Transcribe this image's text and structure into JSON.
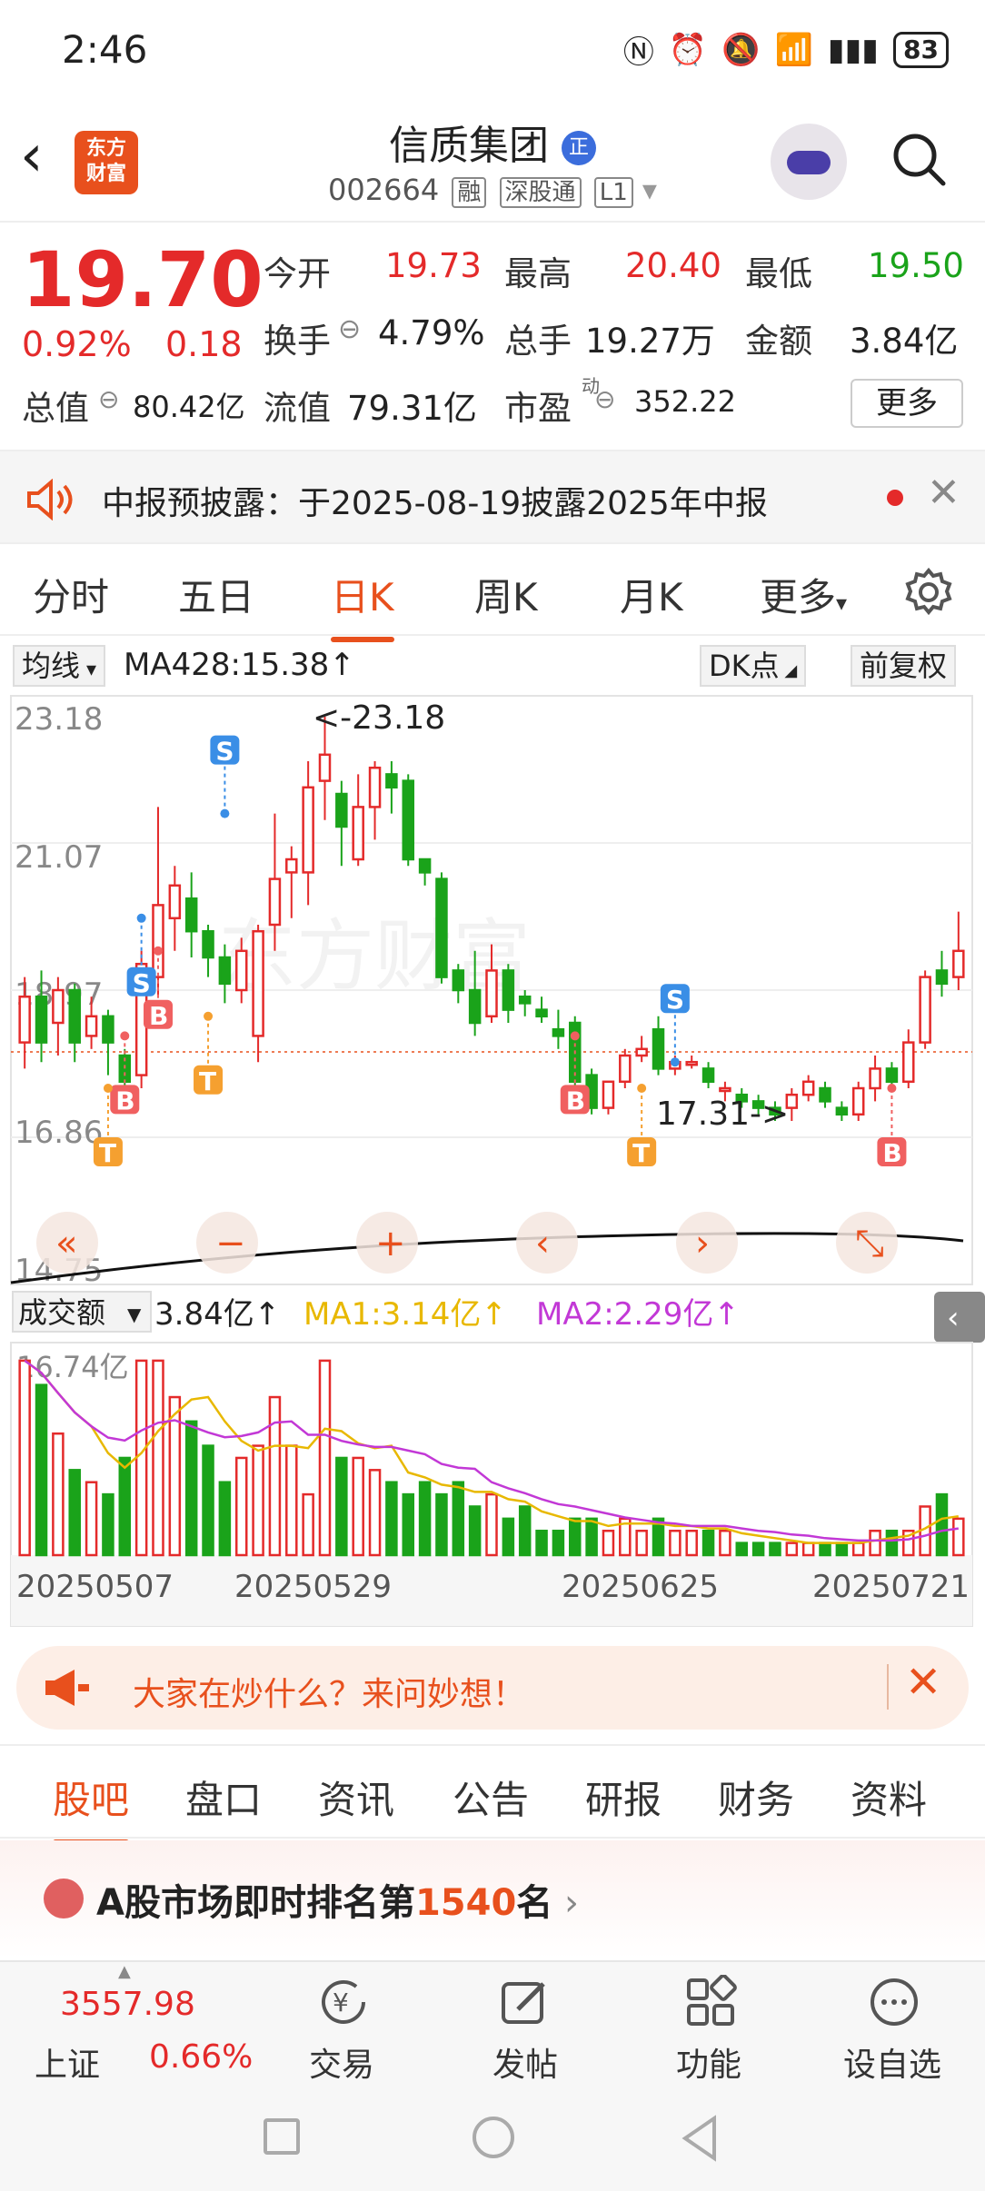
{
  "status_bar": {
    "time": "2:46",
    "battery": "83"
  },
  "header": {
    "back_icon": "back-arrow-icon",
    "app_logo": "东方\n财富",
    "stock_name": "信质集团",
    "name_badge": "正",
    "stock_code": "002664",
    "badges": [
      "融",
      "深股通",
      "L1"
    ]
  },
  "quote": {
    "price": "19.70",
    "change_pct": "0.92%",
    "change": "0.18",
    "open_label": "今开",
    "open": "19.73",
    "high_label": "最高",
    "high": "20.40",
    "low_label": "最低",
    "low": "19.50",
    "turnover_label": "换手",
    "turnover": "4.79%",
    "volume_label": "总手",
    "volume": "19.27万",
    "amount_label": "金额",
    "amount": "3.84亿",
    "mktcap_label": "总值",
    "mktcap": "80.42亿",
    "float_label": "流值",
    "float": "79.31亿",
    "pe_label": "市盈",
    "pe_sup": "动",
    "pe": "352.22",
    "more_label": "更多"
  },
  "notice": {
    "text": "中报预披露：于2025-08-19披露2025年中报"
  },
  "tabs": [
    "分时",
    "五日",
    "日K",
    "周K",
    "月K",
    "更多"
  ],
  "active_tab": "日K",
  "chart_controls": {
    "ma_dropdown": "均线",
    "ma_text": "MA428:15.38↑",
    "dk_btn": "DK点",
    "adjust_btn": "前复权"
  },
  "chart_data": {
    "type": "candlestick",
    "y_ticks": [
      "23.18",
      "21.07",
      "18.97",
      "16.86",
      "14.75"
    ],
    "max_label": "<-23.18",
    "min_label": "17.31->",
    "signals": [
      "S",
      "B",
      "T"
    ],
    "candles": [
      [
        18.2,
        18.9,
        17.8,
        19.2
      ],
      [
        18.9,
        18.2,
        17.9,
        19.3
      ],
      [
        18.5,
        19.0,
        18.0,
        19.2
      ],
      [
        19.0,
        18.2,
        17.9,
        19.1
      ],
      [
        18.3,
        18.6,
        18.1,
        18.9
      ],
      [
        18.6,
        18.2,
        17.7,
        18.7
      ],
      [
        18.0,
        17.6,
        17.4,
        18.1
      ],
      [
        17.7,
        19.4,
        17.5,
        19.6
      ],
      [
        19.2,
        20.3,
        18.9,
        21.8
      ],
      [
        20.1,
        20.6,
        19.6,
        20.9
      ],
      [
        20.4,
        19.9,
        19.5,
        20.8
      ],
      [
        19.9,
        19.5,
        19.2,
        20.0
      ],
      [
        19.5,
        19.1,
        18.8,
        19.7
      ],
      [
        19.0,
        19.6,
        18.8,
        19.8
      ],
      [
        18.3,
        19.9,
        17.9,
        20.0
      ],
      [
        20.0,
        20.7,
        19.6,
        21.7
      ],
      [
        20.8,
        21.0,
        20.1,
        21.2
      ],
      [
        20.8,
        22.1,
        20.3,
        22.5
      ],
      [
        22.2,
        22.6,
        21.6,
        23.18
      ],
      [
        22.0,
        21.5,
        20.9,
        22.2
      ],
      [
        21.0,
        21.8,
        20.9,
        22.3
      ],
      [
        21.8,
        22.4,
        21.3,
        22.5
      ],
      [
        22.3,
        22.1,
        21.7,
        22.5
      ],
      [
        22.2,
        21.0,
        20.9,
        22.3
      ],
      [
        21.0,
        20.8,
        20.6,
        21.0
      ],
      [
        20.7,
        19.2,
        19.1,
        20.8
      ],
      [
        19.3,
        19.0,
        18.8,
        19.4
      ],
      [
        19.0,
        18.5,
        18.3,
        19.6
      ],
      [
        18.6,
        19.3,
        18.5,
        19.7
      ],
      [
        19.3,
        18.7,
        18.5,
        19.4
      ],
      [
        18.9,
        18.8,
        18.6,
        19.0
      ],
      [
        18.7,
        18.6,
        18.5,
        18.9
      ],
      [
        18.4,
        18.3,
        18.1,
        18.7
      ],
      [
        18.5,
        17.6,
        17.4,
        18.6
      ],
      [
        17.7,
        17.2,
        17.1,
        17.8
      ],
      [
        17.2,
        17.6,
        17.1,
        17.6
      ],
      [
        17.6,
        18.0,
        17.5,
        18.1
      ],
      [
        18.0,
        18.1,
        17.9,
        18.3
      ],
      [
        18.4,
        17.8,
        17.7,
        18.6
      ],
      [
        17.8,
        17.9,
        17.7,
        18.0
      ],
      [
        17.9,
        17.9,
        17.8,
        18.0
      ],
      [
        17.8,
        17.6,
        17.5,
        17.9
      ],
      [
        17.5,
        17.5,
        17.3,
        17.6
      ],
      [
        17.4,
        17.3,
        17.2,
        17.5
      ],
      [
        17.3,
        17.2,
        17.1,
        17.4
      ],
      [
        17.2,
        17.1,
        17.0,
        17.3
      ],
      [
        17.2,
        17.4,
        17.0,
        17.5
      ],
      [
        17.4,
        17.6,
        17.3,
        17.7
      ],
      [
        17.5,
        17.3,
        17.2,
        17.6
      ],
      [
        17.2,
        17.1,
        17.0,
        17.3
      ],
      [
        17.1,
        17.5,
        17.0,
        17.6
      ],
      [
        17.5,
        17.8,
        17.3,
        18.0
      ],
      [
        17.8,
        17.6,
        17.5,
        17.9
      ],
      [
        17.6,
        18.2,
        17.5,
        18.4
      ],
      [
        18.2,
        19.2,
        18.1,
        19.3
      ],
      [
        19.3,
        19.1,
        18.9,
        19.6
      ],
      [
        19.2,
        19.6,
        19.0,
        20.2
      ]
    ],
    "ma_y": 15.38,
    "volume": {
      "dropdown": "成交额",
      "value": "3.84亿↑",
      "ma1": "MA1:3.14亿↑",
      "ma2": "MA2:2.29亿↑",
      "y_max_label": "16.74亿",
      "x_labels": [
        "20250507",
        "20250529",
        "20250625",
        "20250721"
      ],
      "bars": [
        16,
        14,
        10,
        7,
        6,
        5,
        8,
        16,
        16,
        13,
        11,
        9,
        6,
        8,
        9,
        13,
        9,
        5,
        16,
        8,
        8,
        7,
        6,
        5,
        6,
        5,
        6,
        4,
        5,
        3,
        4,
        2,
        2,
        3,
        3,
        2,
        3,
        2,
        3,
        2,
        2,
        2,
        2,
        1,
        1,
        1,
        1,
        1,
        1,
        1,
        1,
        2,
        2,
        2,
        4,
        5,
        3
      ]
    }
  },
  "chart_nav_icons": [
    "double-left-icon",
    "minus-icon",
    "plus-icon",
    "left-icon",
    "right-icon",
    "expand-icon"
  ],
  "hint_banner": {
    "text": "大家在炒什么？来问妙想！"
  },
  "sub_tabs": [
    "股吧",
    "盘口",
    "资讯",
    "公告",
    "研报",
    "财务",
    "资料"
  ],
  "active_sub_tab": "股吧",
  "rank": {
    "prefix": "A股市场即时排名第",
    "number": "1540",
    "suffix": "名"
  },
  "bottom_nav": {
    "index_value": "3557.98",
    "index_name": "上证",
    "index_change": "0.66%",
    "items": [
      {
        "label": "交易",
        "icon": "trade-icon"
      },
      {
        "label": "发帖",
        "icon": "post-icon"
      },
      {
        "label": "功能",
        "icon": "grid-icon"
      },
      {
        "label": "设自选",
        "icon": "more-icon"
      }
    ]
  },
  "colors": {
    "up": "#e42a2a",
    "down": "#1aa31a",
    "accent": "#e8501d"
  }
}
